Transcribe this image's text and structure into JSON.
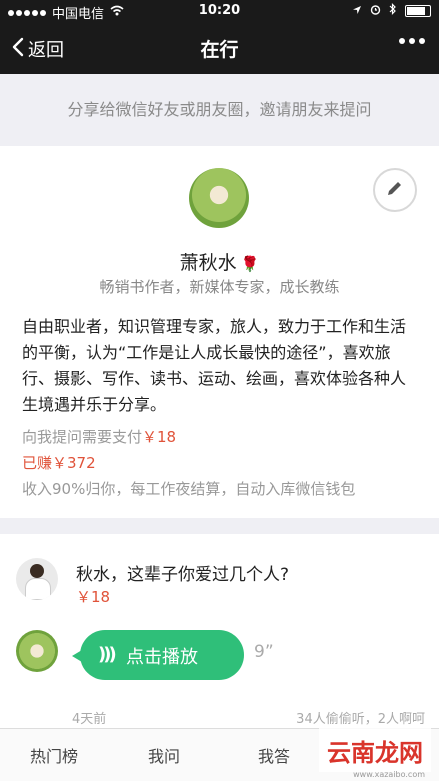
{
  "status_bar": {
    "carrier": "中国电信",
    "time": "10:20"
  },
  "nav": {
    "back_label": "返回",
    "title": "在行"
  },
  "share_banner": "分享给微信好友或朋友圈，邀请朋友来提问",
  "profile": {
    "name": "萧秋水",
    "subtitle": "畅销书作者，新媒体专家，成长教练",
    "bio": "自由职业者，知识管理专家，旅人，致力于工作和生活的平衡，认为“工作是让人成长最快的途径”，喜欢旅行、摄影、写作、读书、运动、绘画，喜欢体验各种人生境遇并乐于分享。",
    "fee_label": "向我提问需要支付",
    "fee_value": "￥18",
    "earned": "已赚￥372",
    "income_note": "收入90%归你，每工作夜结算，自动入库微信钱包"
  },
  "question": {
    "text": "秋水，这辈子你爱过几个人?",
    "price": "￥18",
    "play_label": "点击播放",
    "duration": "9”",
    "time_ago": "4天前",
    "listeners": "34人偷偷听，2人啊呵"
  },
  "tabs": [
    "热门榜",
    "我问",
    "我答"
  ],
  "watermark": {
    "text": "云南龙网",
    "url": "www.xazaibo.com"
  }
}
